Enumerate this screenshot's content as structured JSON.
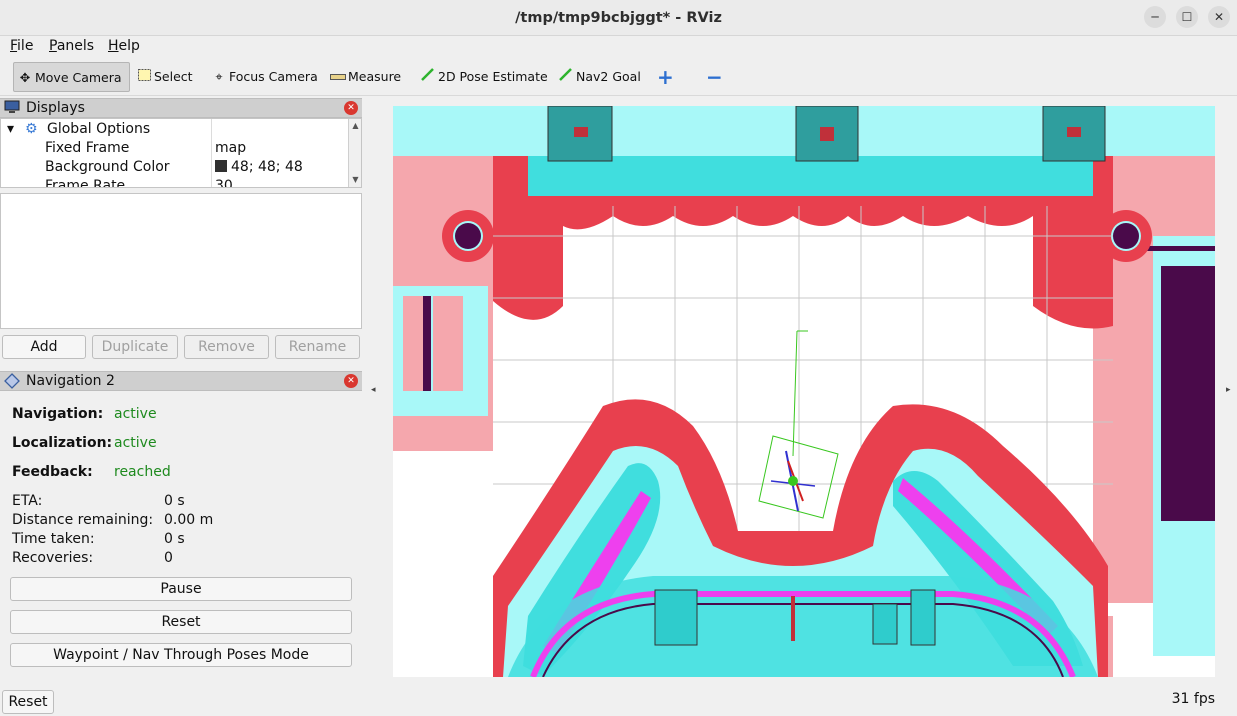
{
  "window": {
    "title": "/tmp/tmp9bcbjggt* - RViz",
    "minimize": "─",
    "maximize": "☐",
    "close": "✕"
  },
  "menu": {
    "file": "File",
    "panels": "Panels",
    "help": "Help"
  },
  "toolbar": {
    "move_camera": "Move Camera",
    "select": "Select",
    "focus_camera": "Focus Camera",
    "measure": "Measure",
    "pose_estimate": "2D Pose Estimate",
    "nav2_goal": "Nav2 Goal",
    "add_tool": "+",
    "remove_tool": "−"
  },
  "displays": {
    "title": "Displays",
    "global_options": "Global Options",
    "props": [
      {
        "key": "Fixed Frame",
        "value": "map"
      },
      {
        "key": "Background Color",
        "value": "48; 48; 48"
      },
      {
        "key": "Frame Rate",
        "value": "30"
      }
    ],
    "buttons": {
      "add": "Add",
      "duplicate": "Duplicate",
      "remove": "Remove",
      "rename": "Rename"
    }
  },
  "navigation": {
    "title": "Navigation 2",
    "states": [
      {
        "label": "Navigation:",
        "value": "active"
      },
      {
        "label": "Localization:",
        "value": "active"
      },
      {
        "label": "Feedback:",
        "value": "reached"
      }
    ],
    "stats": [
      {
        "label": "ETA:",
        "value": "0 s"
      },
      {
        "label": "Distance remaining:",
        "value": "0.00 m"
      },
      {
        "label": "Time taken:",
        "value": "0 s"
      },
      {
        "label": "Recoveries:",
        "value": "0"
      }
    ],
    "buttons": {
      "pause": "Pause",
      "reset": "Reset",
      "mode": "Waypoint / Nav Through Poses Mode"
    }
  },
  "status": {
    "reset": "Reset",
    "fps": "31 fps"
  },
  "colors": {
    "costmap_red": "#e8404e",
    "costmap_pink": "#f5a7ad",
    "costmap_cyan": "#a8f8f8",
    "inflation_teal": "#40dede",
    "obstacle_magenta": "#ee40ee",
    "wall_dark": "#4a0a4a",
    "selection_green": "#39c71f"
  }
}
